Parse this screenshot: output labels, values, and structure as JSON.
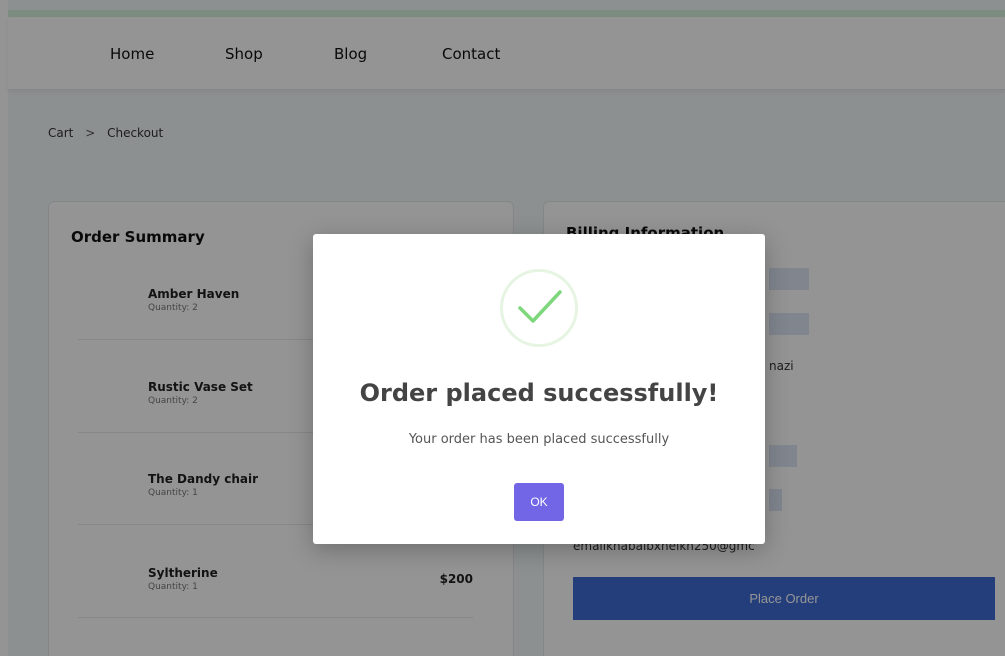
{
  "nav": {
    "items": [
      {
        "label": "Home"
      },
      {
        "label": "Shop"
      },
      {
        "label": "Blog"
      },
      {
        "label": "Contact"
      }
    ]
  },
  "breadcrumb": {
    "items": [
      "Cart",
      "Checkout"
    ],
    "separator": ">"
  },
  "order_summary": {
    "title": "Order Summary",
    "items": [
      {
        "name": "Amber Haven",
        "quantity": "Quantity: 2",
        "price": ""
      },
      {
        "name": "Rustic Vase Set",
        "quantity": "Quantity: 2",
        "price": ""
      },
      {
        "name": "The Dandy chair",
        "quantity": "Quantity: 1",
        "price": ""
      },
      {
        "name": "Syltherine",
        "quantity": "Quantity: 1",
        "price": "$200"
      }
    ]
  },
  "billing": {
    "title": "Billing Information",
    "partial_name_text": "nazi",
    "partial_email_text": "emailkhabaibxhelkh250@gmc",
    "place_order_label": "Place Order"
  },
  "modal": {
    "title": "Order placed successfully!",
    "message": "Your order has been placed successfully",
    "ok_label": "OK"
  },
  "colors": {
    "accent_bar": "#d6f2dc",
    "place_order_bg": "#3e6bd6",
    "ok_button_bg": "#7266e6",
    "success_check": "#7ed77c"
  }
}
